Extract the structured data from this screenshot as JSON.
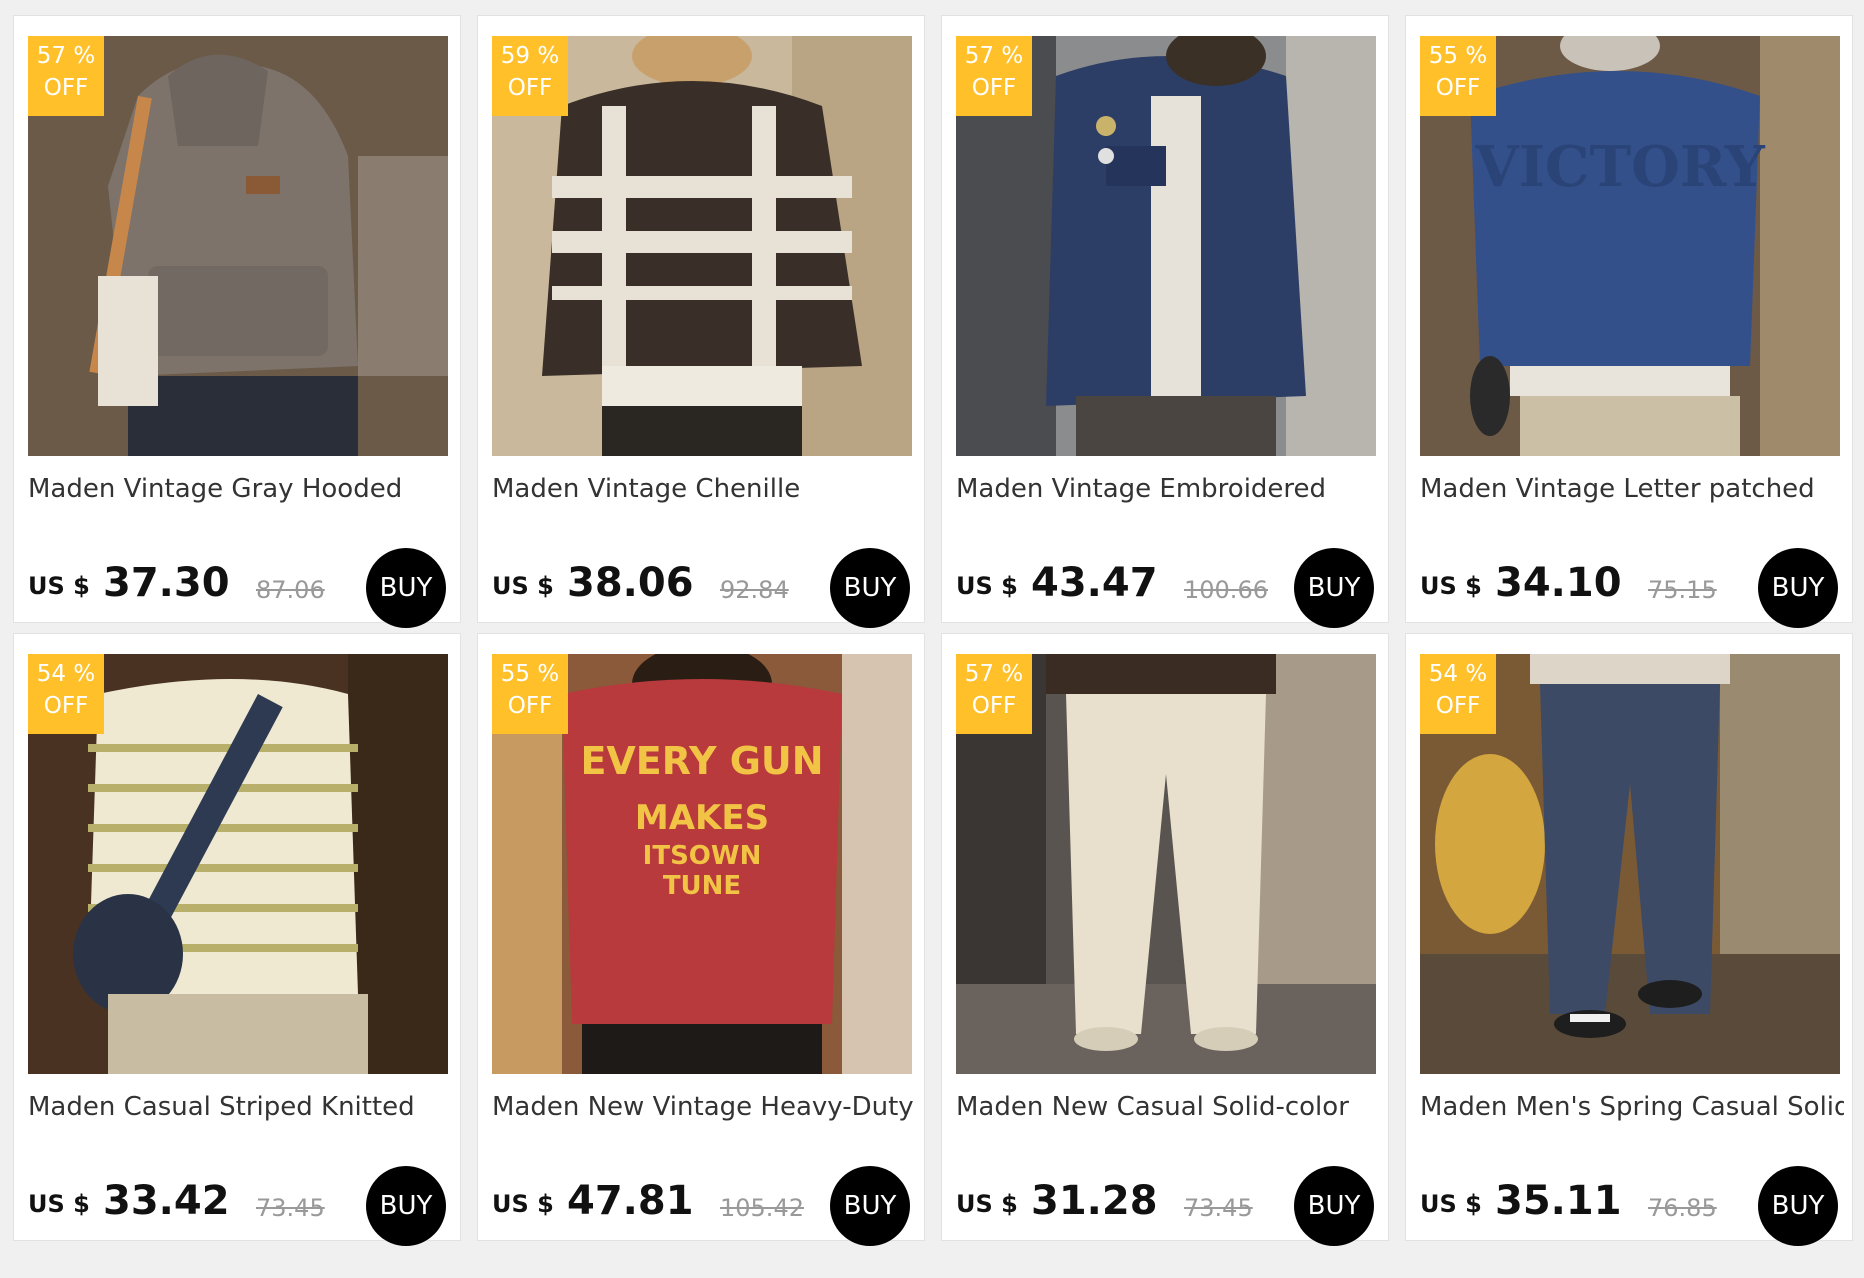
{
  "products": [
    {
      "discount_line1": "57 %",
      "discount_line2": "OFF",
      "title": "Maden Vintage Gray Hooded",
      "currency": "US $",
      "price": "37.30",
      "original_price": "87.06",
      "buy_label": "BUY",
      "image_desc": "gray-hoodie"
    },
    {
      "discount_line1": "59 %",
      "discount_line2": "OFF",
      "title": "Maden Vintage Chenille",
      "currency": "US $",
      "price": "38.06",
      "original_price": "92.84",
      "buy_label": "BUY",
      "image_desc": "striped-sweater"
    },
    {
      "discount_line1": "57 %",
      "discount_line2": "OFF",
      "title": "Maden Vintage Embroidered",
      "currency": "US $",
      "price": "43.47",
      "original_price": "100.66",
      "buy_label": "BUY",
      "image_desc": "denim-jacket"
    },
    {
      "discount_line1": "55 %",
      "discount_line2": "OFF",
      "title": "Maden Vintage Letter patched",
      "currency": "US $",
      "price": "34.10",
      "original_price": "75.15",
      "buy_label": "BUY",
      "image_desc": "blue-sweatshirt"
    },
    {
      "discount_line1": "54 %",
      "discount_line2": "OFF",
      "title": "Maden Casual Striped Knitted",
      "currency": "US $",
      "price": "33.42",
      "original_price": "73.45",
      "buy_label": "BUY",
      "image_desc": "striped-polo"
    },
    {
      "discount_line1": "55 %",
      "discount_line2": "OFF",
      "title": "Maden New Vintage Heavy-Duty",
      "currency": "US $",
      "price": "47.81",
      "original_price": "105.42",
      "buy_label": "BUY",
      "image_desc": "red-jacket",
      "image_text": [
        "EVERY GUN",
        "MAKES",
        "ITSOWN",
        "TUNE"
      ]
    },
    {
      "discount_line1": "57 %",
      "discount_line2": "OFF",
      "title": "Maden New Casual Solid-color",
      "currency": "US $",
      "price": "31.28",
      "original_price": "73.45",
      "buy_label": "BUY",
      "image_desc": "cream-pants"
    },
    {
      "discount_line1": "54 %",
      "discount_line2": "OFF",
      "title": "Maden Men's Spring Casual Solid",
      "currency": "US $",
      "price": "35.11",
      "original_price": "76.85",
      "buy_label": "BUY",
      "image_desc": "navy-pants"
    }
  ],
  "colors": {
    "badge": "#ffc02a",
    "buy_button": "#000000",
    "page_bg": "#f0f0f0"
  }
}
